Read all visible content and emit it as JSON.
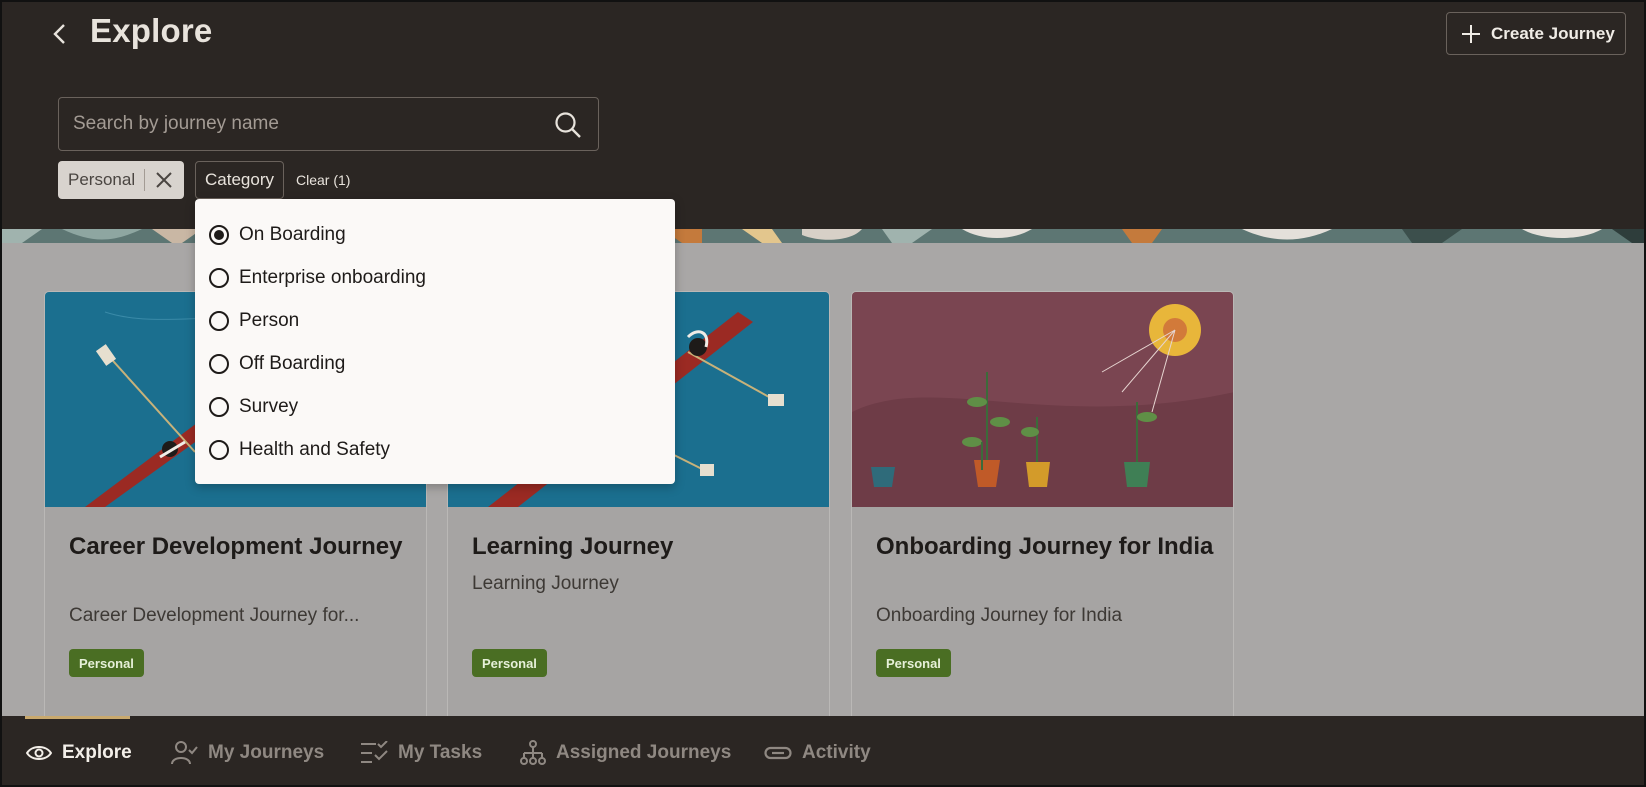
{
  "header": {
    "title": "Explore",
    "create_label": "Create Journey"
  },
  "search": {
    "placeholder": "Search by journey name",
    "value": ""
  },
  "filters": {
    "chip_label": "Personal",
    "category_label": "Category",
    "clear_label": "Clear (1)"
  },
  "dropdown": {
    "selected": "On Boarding",
    "options": [
      "On Boarding",
      "Enterprise onboarding",
      "Person",
      "Off Boarding",
      "Survey",
      "Health and Safety"
    ]
  },
  "cards": [
    {
      "title": "Career Development Journey",
      "subtitle": "Career Development Journey for...",
      "badge": "Personal"
    },
    {
      "title": "Learning Journey",
      "subtitle": "Learning Journey",
      "badge": "Personal"
    },
    {
      "title": "Onboarding Journey for India",
      "subtitle": "Onboarding Journey for India",
      "badge": "Personal"
    }
  ],
  "nav": {
    "items": [
      "Explore",
      "My Journeys",
      "My Tasks",
      "Assigned Journeys",
      "Activity"
    ],
    "active": "Explore"
  },
  "colors": {
    "header_bg": "#2b2623",
    "badge_green": "#4a6e23",
    "active_accent": "#c9a96e",
    "card_blue": "#1b6f8f",
    "card_plum": "#7a4551"
  },
  "icons": [
    "back-chevron-icon",
    "plus-icon",
    "search-icon",
    "close-icon",
    "eye-icon",
    "user-check-icon",
    "task-list-icon",
    "hierarchy-icon",
    "link-icon"
  ]
}
